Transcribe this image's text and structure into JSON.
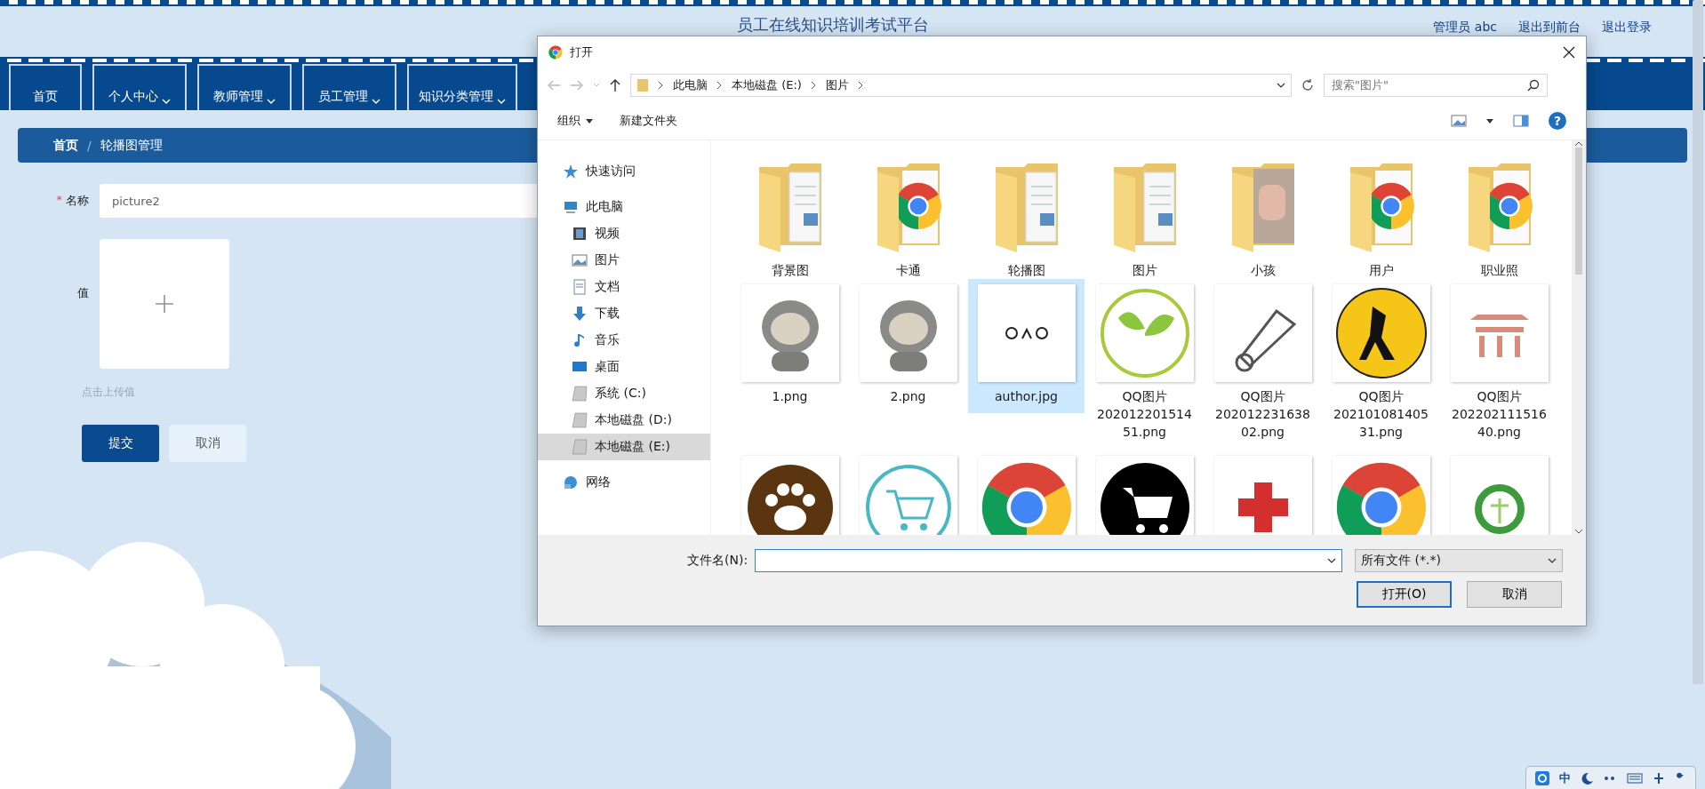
{
  "page": {
    "title": "员工在线知识培训考试平台",
    "user": "管理员 abc",
    "links": [
      "退出到前台",
      "退出登录"
    ]
  },
  "nav": [
    {
      "label": "首页",
      "dropdown": false
    },
    {
      "label": "个人中心",
      "dropdown": true
    },
    {
      "label": "教师管理",
      "dropdown": true
    },
    {
      "label": "员工管理",
      "dropdown": true
    },
    {
      "label": "知识分类管理",
      "dropdown": true
    }
  ],
  "breadcrumb": {
    "items": [
      "首页",
      "轮播图管理"
    ],
    "separator": "/"
  },
  "form": {
    "required_mark": "*",
    "name_label": "名称",
    "name_value": "picture2",
    "value_label": "值",
    "upload_hint": "点击上传值",
    "buttons": [
      {
        "label": "提交",
        "kind": "primary"
      },
      {
        "label": "取消",
        "kind": "plain"
      }
    ]
  },
  "dialog": {
    "title": "打开",
    "path": [
      "此电脑",
      "本地磁盘 (E:)",
      "图片"
    ],
    "search_placeholder": "搜索\"图片\"",
    "toolbar": [
      "组织",
      "新建文件夹"
    ],
    "help": "?",
    "sidebar": [
      {
        "label": "快速访问",
        "kind": "star",
        "selected": false
      },
      {
        "label": "此电脑",
        "kind": "pc",
        "selected": false,
        "children": [
          {
            "label": "视频",
            "kind": "video",
            "selected": false
          },
          {
            "label": "图片",
            "kind": "picture",
            "selected": false
          },
          {
            "label": "文档",
            "kind": "document",
            "selected": false
          },
          {
            "label": "下载",
            "kind": "download",
            "selected": false
          },
          {
            "label": "音乐",
            "kind": "music",
            "selected": false
          },
          {
            "label": "桌面",
            "kind": "desktop",
            "selected": false
          },
          {
            "label": "系统 (C:)",
            "kind": "drive",
            "selected": false
          },
          {
            "label": "本地磁盘 (D:)",
            "kind": "drive",
            "selected": false
          },
          {
            "label": "本地磁盘 (E:)",
            "kind": "drive",
            "selected": true
          }
        ]
      },
      {
        "label": "网络",
        "kind": "network",
        "selected": false
      }
    ],
    "files": [
      {
        "name": "背景图",
        "kind": "docsfolder",
        "selected": false
      },
      {
        "name": "卡通",
        "kind": "chromefolder",
        "selected": false
      },
      {
        "name": "轮播图",
        "kind": "docsfolder",
        "selected": false
      },
      {
        "name": "图片",
        "kind": "docsfolder",
        "selected": false
      },
      {
        "name": "小孩",
        "kind": "photofolder",
        "selected": false
      },
      {
        "name": "用户",
        "kind": "chromefolder",
        "selected": false
      },
      {
        "name": "职业照",
        "kind": "chromefolder",
        "selected": false
      },
      {
        "name": "1.png",
        "kind": "cartoon",
        "selected": false
      },
      {
        "name": "2.png",
        "kind": "cartoon",
        "selected": false
      },
      {
        "name": "author.jpg",
        "kind": "logo",
        "selected": true
      },
      {
        "name": "QQ图片20201220151451.png",
        "kind": "leaf",
        "selected": false
      },
      {
        "name": "QQ图片20201223163802.png",
        "kind": "shuttlecock",
        "selected": false
      },
      {
        "name": "QQ图片20210108140531.png",
        "kind": "badge",
        "selected": false
      },
      {
        "name": "QQ图片20220211151640.png",
        "kind": "building",
        "selected": false
      },
      {
        "kind": "paw",
        "selected": false
      },
      {
        "kind": "cart",
        "selected": false
      },
      {
        "kind": "chrome",
        "selected": false
      },
      {
        "kind": "darkcart",
        "selected": false
      },
      {
        "kind": "cross",
        "selected": false
      },
      {
        "kind": "chrome",
        "selected": false
      },
      {
        "kind": "ring",
        "selected": false
      }
    ],
    "filename_label": "文件名(N):",
    "filter": "所有文件 (*.*)",
    "buttons": [
      {
        "label": "打开(O)",
        "kind": "default"
      },
      {
        "label": "取消",
        "kind": "plain"
      }
    ]
  },
  "tray": {
    "ime": "中"
  }
}
